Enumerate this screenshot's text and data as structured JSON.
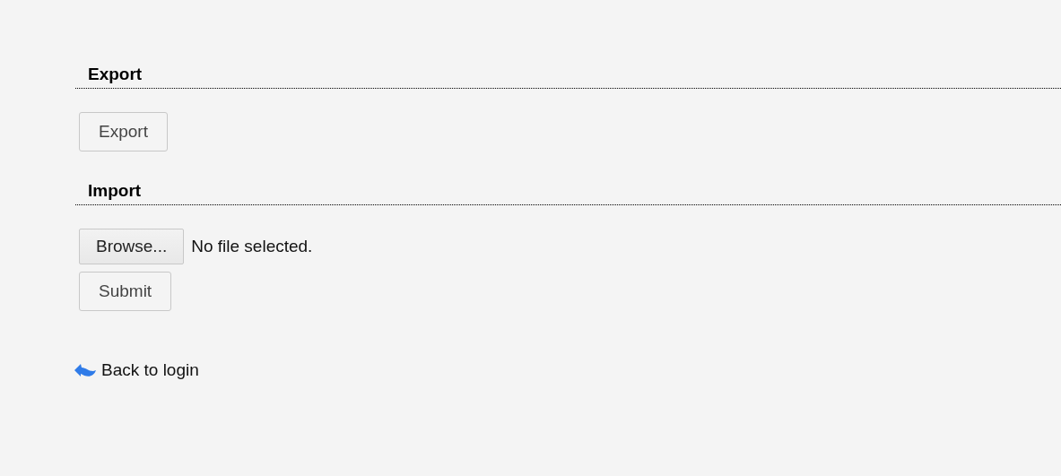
{
  "sections": [
    {
      "kind": "export",
      "title": "Export",
      "button": "Export"
    },
    {
      "kind": "import",
      "title": "Import",
      "browse_button": "Browse...",
      "file_status": "No file selected.",
      "submit_button": "Submit"
    }
  ],
  "back_link": "Back to login"
}
